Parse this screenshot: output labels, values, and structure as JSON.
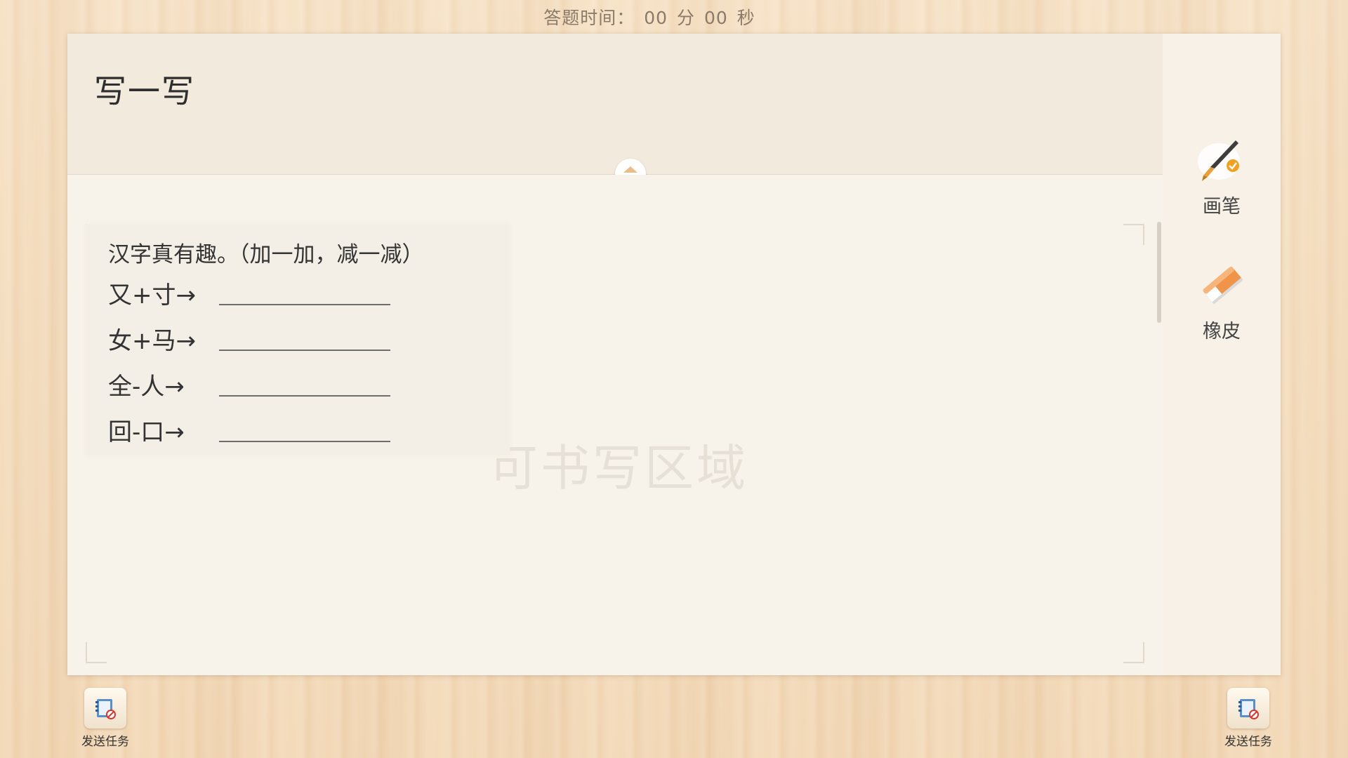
{
  "timer": {
    "label": "答题时间：",
    "minutes": "00",
    "min_unit": "分",
    "seconds": "00",
    "sec_unit": "秒"
  },
  "card": {
    "title": "写一写"
  },
  "question": {
    "prompt": "汉字真有趣。（加一加，减一减）",
    "rows": [
      {
        "expr": "又+寸→"
      },
      {
        "expr": "女+马→"
      },
      {
        "expr": "全-人→"
      },
      {
        "expr": "回-口→"
      }
    ]
  },
  "watermark": "可书写区域",
  "tools": {
    "pen_label": "画笔",
    "eraser_label": "橡皮"
  },
  "footer": {
    "send_left_label": "发送任务",
    "send_right_label": "发送任务"
  },
  "colors": {
    "card_bg": "#f7f1e7",
    "header_bg": "#f2eadd",
    "text": "#333333",
    "wood": "#f3dcbc"
  }
}
